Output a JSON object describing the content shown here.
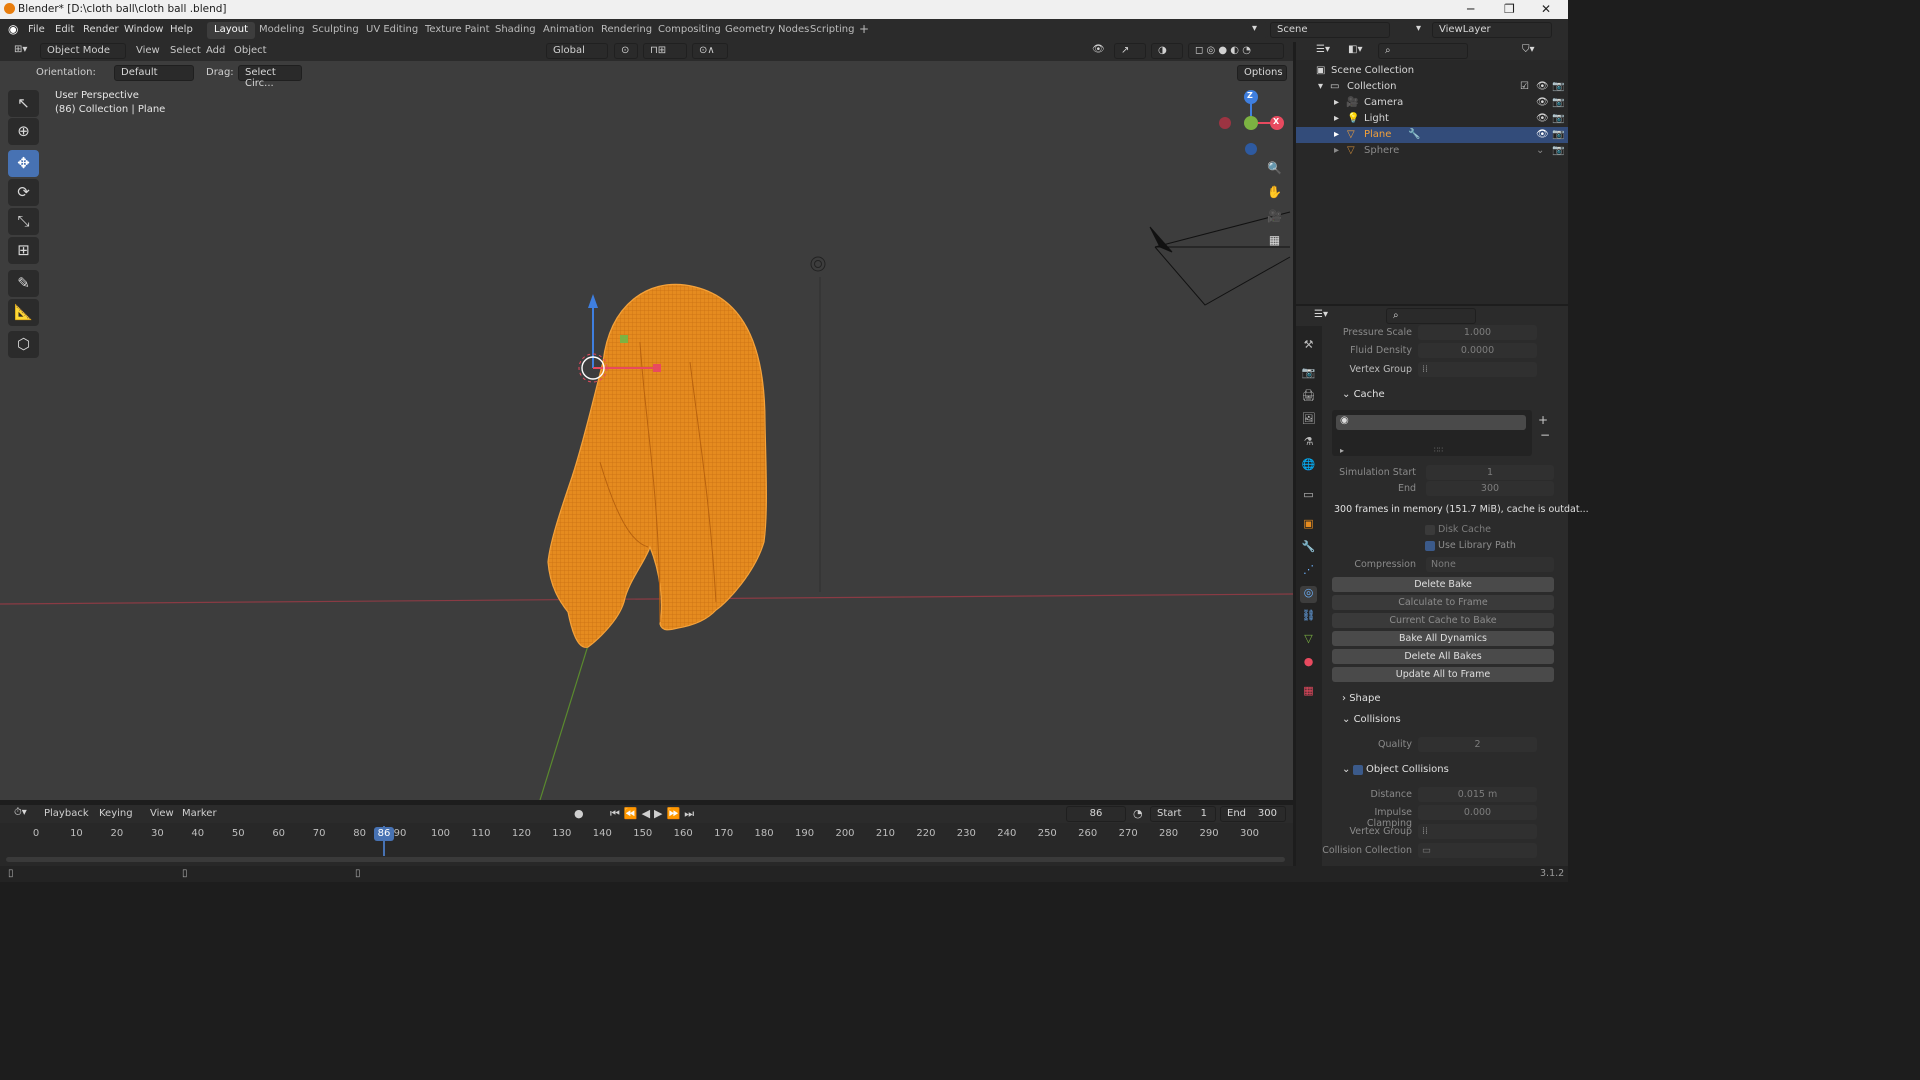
{
  "window": {
    "title": "Blender* [D:\\cloth ball\\cloth ball .blend]",
    "minimize": "─",
    "maximize": "❐",
    "close": "✕"
  },
  "menu": [
    "File",
    "Edit",
    "Render",
    "Window",
    "Help"
  ],
  "workspaces": [
    "Layout",
    "Modeling",
    "Sculpting",
    "UV Editing",
    "Texture Paint",
    "Shading",
    "Animation",
    "Rendering",
    "Compositing",
    "Geometry Nodes",
    "Scripting",
    "+"
  ],
  "scene": "Scene",
  "view_layer": "ViewLayer",
  "viewport": {
    "mode": "Object Mode",
    "menus": [
      "View",
      "Select",
      "Add",
      "Object"
    ],
    "transform_orientation": "Global",
    "orientation_label": "Orientation:",
    "orientation_value": "Default",
    "drag_label": "Drag:",
    "drag_value": "Select Circ...",
    "options": "Options",
    "info_line1": "User Perspective",
    "info_line2": "(86) Collection | Plane",
    "gizmo_axes": {
      "z": "Z",
      "x": "X"
    }
  },
  "outliner": {
    "root": "Scene Collection",
    "collection": "Collection",
    "items": [
      "Camera",
      "Light",
      "Plane",
      "Sphere"
    ],
    "selected": "Plane"
  },
  "properties": {
    "pressure_scale_label": "Pressure Scale",
    "pressure_scale": "1.000",
    "fluid_density_label": "Fluid Density",
    "fluid_density": "0.0000",
    "vertex_group_label": "Vertex Group",
    "cache_section": "Cache",
    "sim_start_label": "Simulation Start",
    "sim_start": "1",
    "end_label": "End",
    "end": "300",
    "cache_info": "300 frames in memory (151.7 MiB), cache is outdat...",
    "disk_cache": "Disk Cache",
    "use_library_path": "Use Library Path",
    "compression_label": "Compression",
    "compression": "None",
    "buttons": [
      "Delete Bake",
      "Calculate to Frame",
      "Current Cache to Bake",
      "Bake All Dynamics",
      "Delete All Bakes",
      "Update All to Frame"
    ],
    "shape_section": "Shape",
    "collisions_section": "Collisions",
    "quality_label": "Quality",
    "quality": "2",
    "object_collisions": "Object Collisions",
    "distance_label": "Distance",
    "distance": "0.015 m",
    "impulse_label": "Impulse Clamping",
    "impulse": "0.000",
    "vertex_group2_label": "Vertex Group",
    "collision_collection_label": "Collision Collection"
  },
  "timeline": {
    "menus": [
      "Playback",
      "Keying",
      "View",
      "Marker"
    ],
    "current_frame": "86",
    "start_label": "Start",
    "start": "1",
    "end_label": "End",
    "end": "300",
    "ticks": [
      "0",
      "10",
      "20",
      "30",
      "40",
      "50",
      "60",
      "70",
      "80",
      "90",
      "100",
      "110",
      "120",
      "130",
      "140",
      "150",
      "160",
      "170",
      "180",
      "190",
      "200",
      "210",
      "220",
      "230",
      "240",
      "250",
      "260",
      "270",
      "280",
      "290",
      "300"
    ]
  },
  "status": {
    "version": "3.1.2"
  },
  "colors": {
    "accent": "#4772b3",
    "selection": "#f2a03a",
    "x_axis": "#e84a5f",
    "y_axis": "#7cb342",
    "z_axis": "#3f7fe0"
  }
}
